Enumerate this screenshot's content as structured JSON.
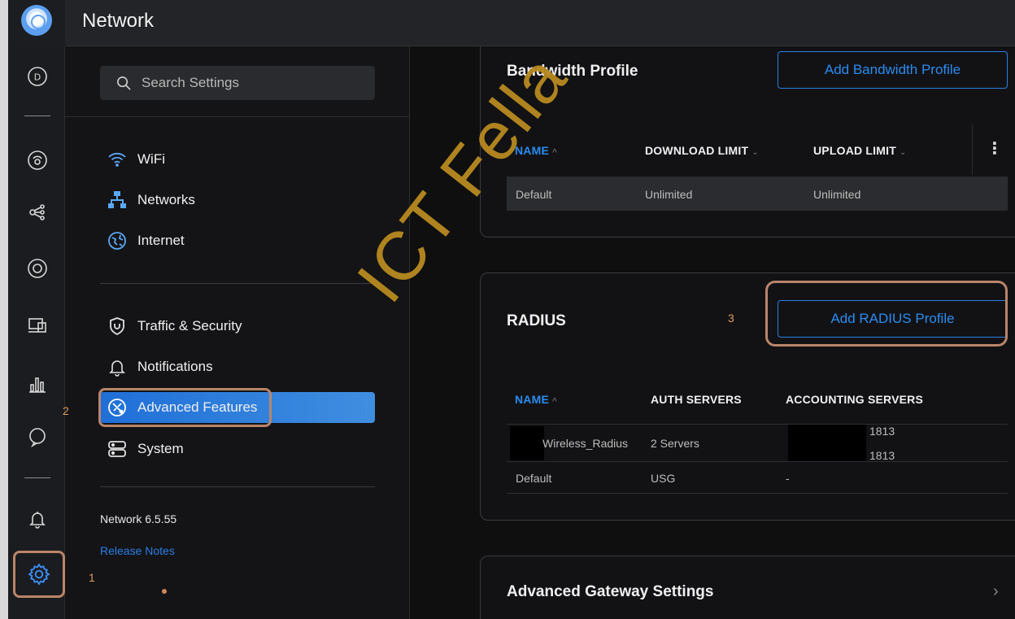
{
  "header": {
    "app_title": "Network"
  },
  "search": {
    "placeholder": "Search Settings"
  },
  "settings_menu": {
    "primary": [
      {
        "label": "WiFi",
        "icon": "wifi-icon"
      },
      {
        "label": "Networks",
        "icon": "networks-icon"
      },
      {
        "label": "Internet",
        "icon": "globe-icon"
      }
    ],
    "secondary": [
      {
        "label": "Traffic & Security",
        "icon": "shield-icon"
      },
      {
        "label": "Notifications",
        "icon": "bell-icon"
      },
      {
        "label": "Advanced Features",
        "icon": "advanced-features-icon",
        "active": true
      },
      {
        "label": "System",
        "icon": "system-icon"
      }
    ],
    "version": "Network 6.5.55",
    "release_notes": "Release Notes"
  },
  "annotations": {
    "one": "1",
    "two": "2",
    "three": "3"
  },
  "bandwidth": {
    "title": "Bandwidth Profile",
    "add_button": "Add Bandwidth Profile",
    "columns": [
      "NAME",
      "DOWNLOAD LIMIT",
      "UPLOAD LIMIT"
    ],
    "rows": [
      {
        "name": "Default",
        "download": "Unlimited",
        "upload": "Unlimited"
      }
    ]
  },
  "radius": {
    "title": "RADIUS",
    "add_button": "Add RADIUS Profile",
    "columns": [
      "NAME",
      "AUTH SERVERS",
      "ACCOUNTING SERVERS"
    ],
    "rows": [
      {
        "name": "Wireless_Radius",
        "auth": "2 Servers",
        "acct_1": "1813",
        "acct_2": "1813"
      },
      {
        "name": "Default",
        "auth": "USG",
        "acct_1": "-"
      }
    ]
  },
  "gateway": {
    "title": "Advanced Gateway Settings"
  },
  "watermark": "ICT Fella",
  "colors": {
    "accent": "#2a8cf0",
    "highlight": "#b9856a",
    "active_bg": "#1f6fd8"
  }
}
